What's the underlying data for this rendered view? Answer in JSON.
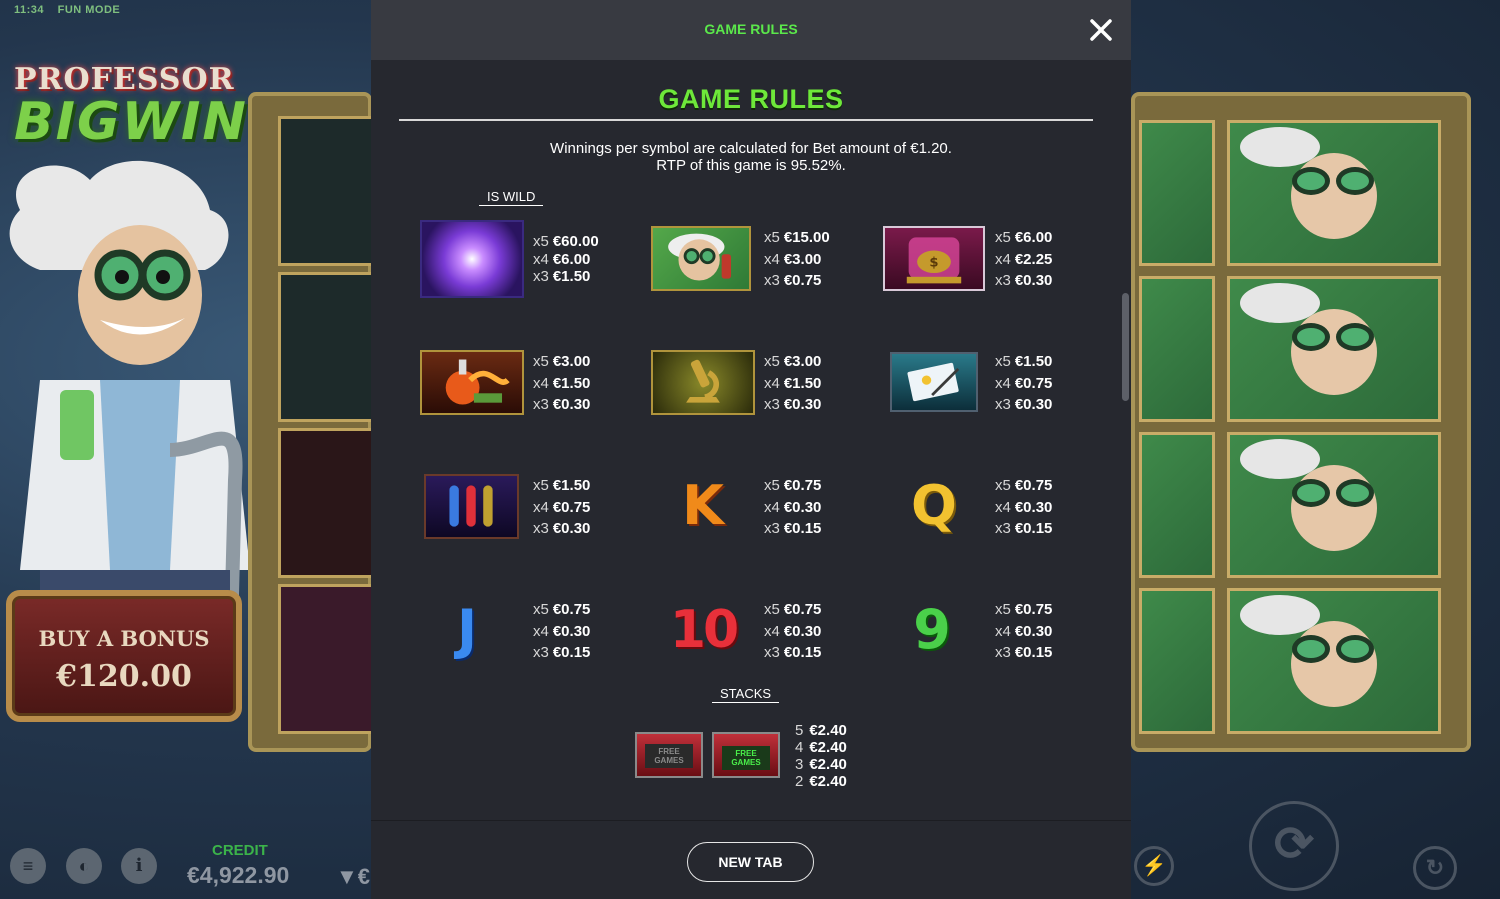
{
  "status_bar": {
    "time": "11:34",
    "mode": "FUN MODE"
  },
  "game": {
    "logo_line1": "PROFESSOR",
    "logo_line2": "BIGWIN",
    "buy_bonus": {
      "label": "BUY A BONUS",
      "price": "€120.00"
    },
    "credit_label": "CREDIT",
    "credit_value": "€4,922.90",
    "bet_stub": "€"
  },
  "modal": {
    "header_title": "GAME RULES",
    "heading": "GAME RULES",
    "intro_line1": "Winnings per symbol are calculated for Bet amount of €1.20.",
    "intro_line2": "RTP of this game is  95.52%.",
    "wild_tag": "IS WILD",
    "stacks_tag": "STACKS",
    "new_tab_label": "NEW TAB",
    "symbols": [
      {
        "name": "plasma-ball",
        "pays": [
          [
            "x5",
            "€60.00"
          ],
          [
            "x4",
            "€6.00"
          ],
          [
            "x3",
            "€1.50"
          ]
        ]
      },
      {
        "name": "professor",
        "pays": [
          [
            "x5",
            "€15.00"
          ],
          [
            "x4",
            "€3.00"
          ],
          [
            "x3",
            "€0.75"
          ]
        ]
      },
      {
        "name": "money-jar",
        "pays": [
          [
            "x5",
            "€6.00"
          ],
          [
            "x4",
            "€2.25"
          ],
          [
            "x3",
            "€0.30"
          ]
        ]
      },
      {
        "name": "flask",
        "pays": [
          [
            "x5",
            "€3.00"
          ],
          [
            "x4",
            "€1.50"
          ],
          [
            "x3",
            "€0.30"
          ]
        ]
      },
      {
        "name": "microscope",
        "pays": [
          [
            "x5",
            "€3.00"
          ],
          [
            "x4",
            "€1.50"
          ],
          [
            "x3",
            "€0.30"
          ]
        ]
      },
      {
        "name": "notepad",
        "pays": [
          [
            "x5",
            "€1.50"
          ],
          [
            "x4",
            "€0.75"
          ],
          [
            "x3",
            "€0.30"
          ]
        ]
      },
      {
        "name": "test-tubes",
        "pays": [
          [
            "x5",
            "€1.50"
          ],
          [
            "x4",
            "€0.75"
          ],
          [
            "x3",
            "€0.30"
          ]
        ]
      },
      {
        "name": "K",
        "pays": [
          [
            "x5",
            "€0.75"
          ],
          [
            "x4",
            "€0.30"
          ],
          [
            "x3",
            "€0.15"
          ]
        ]
      },
      {
        "name": "Q",
        "pays": [
          [
            "x5",
            "€0.75"
          ],
          [
            "x4",
            "€0.30"
          ],
          [
            "x3",
            "€0.15"
          ]
        ]
      },
      {
        "name": "J",
        "pays": [
          [
            "x5",
            "€0.75"
          ],
          [
            "x4",
            "€0.30"
          ],
          [
            "x3",
            "€0.15"
          ]
        ]
      },
      {
        "name": "10",
        "pays": [
          [
            "x5",
            "€0.75"
          ],
          [
            "x4",
            "€0.30"
          ],
          [
            "x3",
            "€0.15"
          ]
        ]
      },
      {
        "name": "9",
        "pays": [
          [
            "x5",
            "€0.75"
          ],
          [
            "x4",
            "€0.30"
          ],
          [
            "x3",
            "€0.15"
          ]
        ]
      }
    ],
    "letters": {
      "k": "K",
      "q": "Q",
      "j": "J",
      "ten": "10",
      "nine": "9"
    },
    "free_games_text": "FREE GAMES",
    "stacks_pays": [
      [
        "5",
        "€2.40"
      ],
      [
        "4",
        "€2.40"
      ],
      [
        "3",
        "€2.40"
      ],
      [
        "2",
        "€2.40"
      ]
    ]
  },
  "colors": {
    "accent_green": "#5be84b",
    "modal_bg": "#26282f",
    "header_bg": "#383a41"
  }
}
